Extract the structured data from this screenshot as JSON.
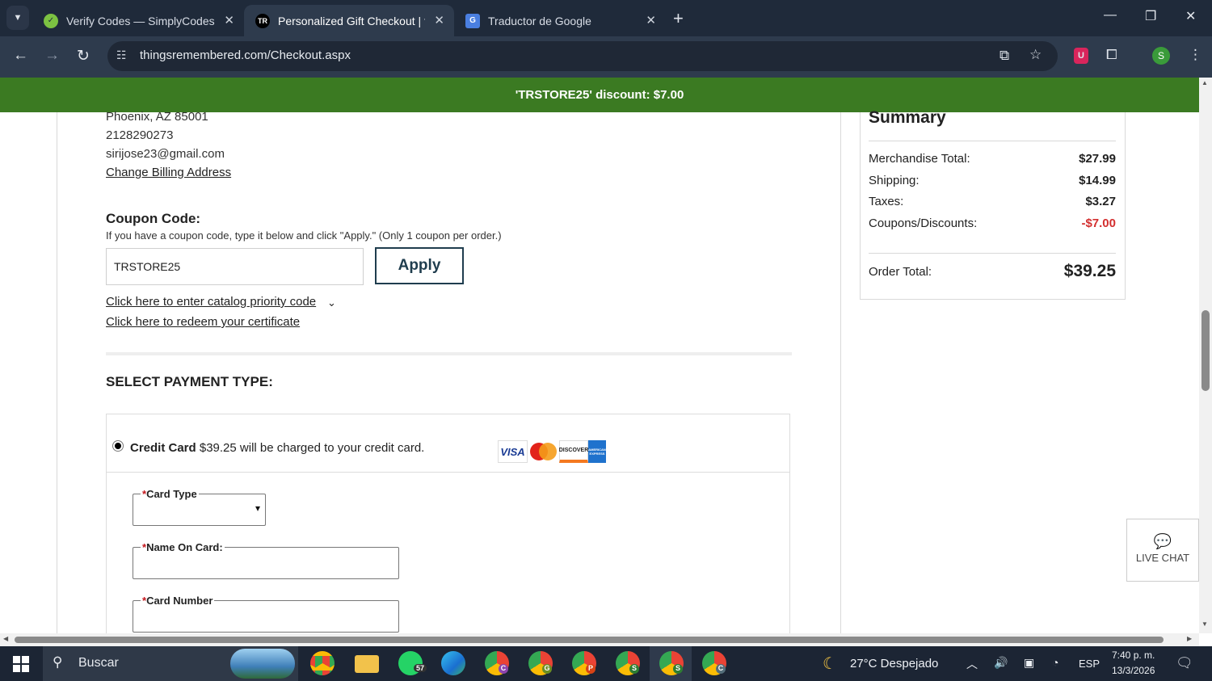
{
  "browser": {
    "tabs": [
      {
        "title": "Verify Codes — SimplyCodes",
        "active": false,
        "icon": "simplycodes-icon",
        "favicon_color": "#7cc242"
      },
      {
        "title": "Personalized Gift Checkout | thi",
        "active": true,
        "icon": "things-remembered-icon",
        "favicon_text": "TR"
      },
      {
        "title": "Traductor de Google",
        "active": false,
        "icon": "google-translate-icon"
      }
    ],
    "url": "thingsremembered.com/Checkout.aspx"
  },
  "promo_banner": "'TRSTORE25' discount: $7.00",
  "billing": {
    "city_line": "Phoenix, AZ 85001",
    "phone": "2128290273",
    "email": "sirijose23@gmail.com",
    "change_link": "Change Billing Address"
  },
  "coupon": {
    "title": "Coupon Code:",
    "help": "If you have a coupon code, type it below and click \"Apply.\" (Only 1 coupon per order.)",
    "value": "TRSTORE25",
    "apply_label": "Apply",
    "catalog_link": "Click here to enter catalog priority code",
    "certificate_link": "Click here to redeem your certificate"
  },
  "payment": {
    "title": "SELECT PAYMENT TYPE:",
    "option_name": "Credit Card",
    "option_desc": "$39.25 will be charged to your credit card.",
    "card_brands": [
      "VISA",
      "MasterCard",
      "DISCOVER",
      "AMERICAN EXPRESS"
    ],
    "fields": {
      "card_type": "Card Type",
      "name_on_card": "Name On Card:",
      "card_number": "Card Number"
    },
    "required_mark": "*"
  },
  "summary": {
    "title": "Summary",
    "rows": [
      {
        "label": "Merchandise Total:",
        "value": "$27.99"
      },
      {
        "label": "Shipping:",
        "value": "$14.99"
      },
      {
        "label": "Taxes:",
        "value": "$3.27"
      },
      {
        "label": "Coupons/Discounts:",
        "value": "-$7.00"
      }
    ],
    "total_label": "Order Total:",
    "total_value": "$39.25"
  },
  "live_chat": "LIVE CHAT",
  "taskbar": {
    "search_placeholder": "Buscar",
    "whatsapp_badge": "57",
    "weather": "27°C  Despejado",
    "language": "ESP",
    "time": "7:40 p. m.",
    "date": "13/3/2026",
    "profile_letters": [
      "C",
      "G",
      "P",
      "S",
      "S",
      "C"
    ]
  },
  "colors": {
    "promo_green": "#3b7a22",
    "discount_red": "#d32f2f",
    "apply_border": "#1f3d4e"
  }
}
